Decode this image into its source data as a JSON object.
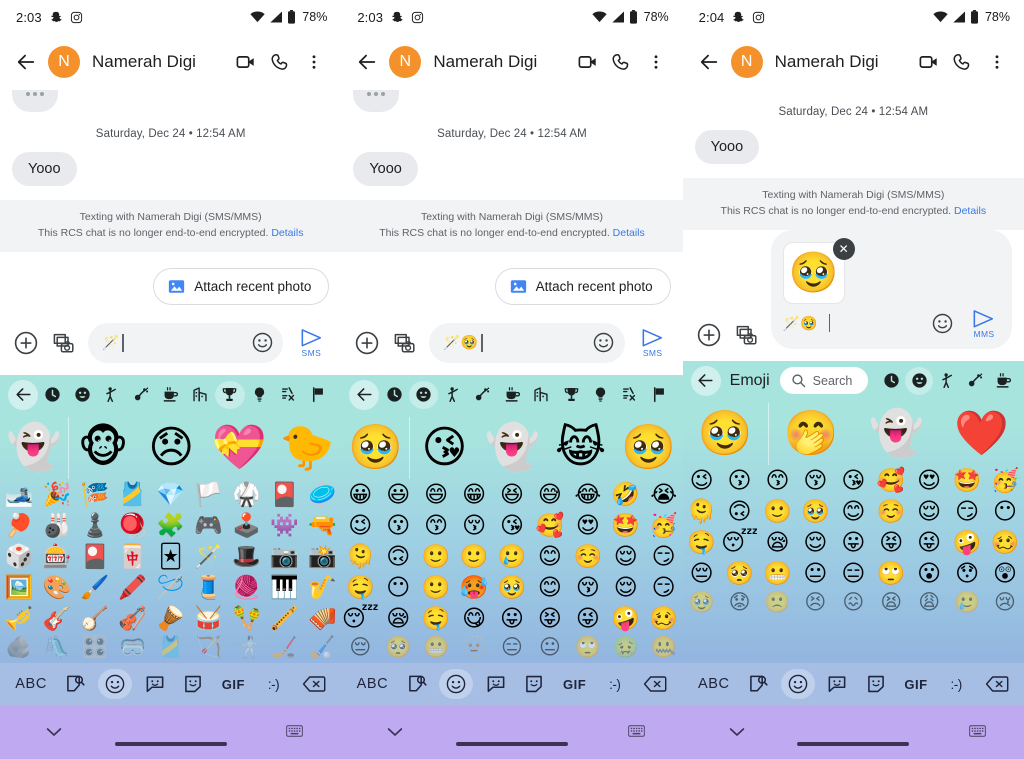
{
  "app": {
    "name": "Google Messages",
    "contact_name": "Namerah Digi",
    "avatar_initial": "N"
  },
  "colors": {
    "accent_blue": "#3b78e7",
    "avatar_orange": "#F5912A",
    "keyboard_top": "#A8E4DE",
    "keyboard_bottom": "#A7BDE4",
    "keyboard_toolbar": "#A6BEE3",
    "navbar_purple": "#BFAAF2",
    "bubble_grey": "#E8EAED",
    "notice_grey": "#F1F3F4"
  },
  "panels": [
    {
      "id": "panel-1",
      "statusbar": {
        "time": "2:03",
        "left_icons": [
          "snapchat-icon",
          "instagram-icon"
        ],
        "right_icons": [
          "wifi-icon",
          "signal-icon",
          "battery-icon"
        ],
        "battery": "78%"
      },
      "appbar": {
        "back": "back-arrow-icon",
        "title": "Namerah Digi",
        "actions": [
          "video-call-icon",
          "phone-call-icon",
          "overflow-menu-icon"
        ]
      },
      "conversation": {
        "typing_indicator": true,
        "datestamp": "Saturday, Dec 24 • 12:54 AM",
        "messages": [
          {
            "from": "them",
            "text": "Yooo"
          }
        ],
        "notice_line1": "Texting with Namerah Digi (SMS/MMS)",
        "notice_line2": "This RCS chat is no longer end-to-end encrypted.",
        "notice_link": "Details"
      },
      "suggestion_chip": {
        "label": "Attach recent photo",
        "icon": "photo-icon"
      },
      "composer": {
        "plus_icon": "plus-circle-icon",
        "gallery_icon": "gallery-camera-icon",
        "text_value": "🪄",
        "placeholder": "Text message",
        "emoji_icon": "smiley-icon",
        "send_icon": "send-icon",
        "send_label": "SMS"
      },
      "keyboard": {
        "show_search": false,
        "back_icon": "back-arrow-icon",
        "label": "",
        "search_placeholder": "",
        "categories": [
          "recent-clock-icon",
          "smileys-icon",
          "people-icon",
          "animals-nature-icon",
          "food-drink-icon",
          "travel-places-icon",
          "activities-icon",
          "objects-icon",
          "symbols-icon",
          "flags-icon"
        ],
        "selected_category": "activities-icon",
        "featured_row": [
          "👻",
          "🐵",
          "😞",
          "💝",
          "🐤"
        ],
        "grid": [
          [
            "🎿",
            "🎉",
            "🎏",
            "🎽",
            "💎",
            "🏳️",
            "🥋",
            "🎴",
            "🥏"
          ],
          [
            "🏓",
            "🎳",
            "♟️",
            "🪀",
            "🧩",
            "🎮",
            "🕹️",
            "👾",
            "🔫"
          ],
          [
            "🎲",
            "🎰",
            "🎴",
            "🀄",
            "🃏",
            "🪄",
            "🎩",
            "📷",
            "📸"
          ],
          [
            "🖼️",
            "🎨",
            "🖌️",
            "🖍️",
            "🪡",
            "🧵",
            "🧶",
            "🎹",
            "🎷"
          ],
          [
            "🎺",
            "🎸",
            "🪕",
            "🎻",
            "🪘",
            "🥁",
            "🪇",
            "🪈",
            "🪗"
          ],
          [
            "🪨",
            "🛝",
            "🎛️",
            "🥽",
            "🎽",
            "🏹",
            "🤺",
            "🏒",
            "🏑"
          ]
        ]
      },
      "kb_toolbar": {
        "items": [
          "ABC",
          "sticker-search-icon",
          "emoji-icon",
          "emoji-kitchen-icon",
          "sticker-icon",
          "GIF",
          ":-)",
          "backspace-icon"
        ],
        "selected": "emoji-icon"
      },
      "navbar": {
        "down_icon": "chevron-down-icon",
        "home_pill": "home-gesture-pill",
        "keyboard_icon": "keyboard-switch-icon"
      }
    },
    {
      "id": "panel-2",
      "statusbar": {
        "time": "2:03",
        "left_icons": [
          "snapchat-icon",
          "instagram-icon"
        ],
        "right_icons": [
          "wifi-icon",
          "signal-icon",
          "battery-icon"
        ],
        "battery": "78%"
      },
      "appbar": {
        "back": "back-arrow-icon",
        "title": "Namerah Digi",
        "actions": [
          "video-call-icon",
          "phone-call-icon",
          "overflow-menu-icon"
        ]
      },
      "conversation": {
        "typing_indicator": true,
        "datestamp": "Saturday, Dec 24 • 12:54 AM",
        "messages": [
          {
            "from": "them",
            "text": "Yooo"
          }
        ],
        "notice_line1": "Texting with Namerah Digi (SMS/MMS)",
        "notice_line2": "This RCS chat is no longer end-to-end encrypted.",
        "notice_link": "Details"
      },
      "suggestion_chip": {
        "label": "Attach recent photo",
        "icon": "photo-icon"
      },
      "composer": {
        "plus_icon": "plus-circle-icon",
        "gallery_icon": "gallery-camera-icon",
        "text_value": "🪄🥹",
        "placeholder": "Text message",
        "emoji_icon": "smiley-icon",
        "send_icon": "send-icon",
        "send_label": "SMS"
      },
      "keyboard": {
        "show_search": false,
        "back_icon": "back-arrow-icon",
        "label": "",
        "search_placeholder": "",
        "categories": [
          "recent-clock-icon",
          "smileys-icon",
          "people-icon",
          "animals-nature-icon",
          "food-drink-icon",
          "travel-places-icon",
          "activities-icon",
          "objects-icon",
          "symbols-icon",
          "flags-icon"
        ],
        "selected_category": "smileys-icon",
        "featured_row": [
          "🥹",
          "😘",
          "👻",
          "😹",
          "🥹"
        ],
        "grid": [
          [
            "😀",
            "😃",
            "😄",
            "😁",
            "😆",
            "😅",
            "😂",
            "🤣",
            "😭"
          ],
          [
            "😉",
            "😗",
            "😙",
            "😚",
            "😘",
            "🥰",
            "😍",
            "🤩",
            "🥳"
          ],
          [
            "🫠",
            "🙃",
            "🙂",
            "🙂",
            "🥲",
            "😊",
            "☺️",
            "😌",
            "😏"
          ],
          [
            "🤤",
            "😶",
            "🙂",
            "🥵",
            "🥹",
            "😊",
            "😚",
            "😌",
            "😏"
          ],
          [
            "😴",
            "😪",
            "🤤",
            "😋",
            "😛",
            "😝",
            "😜",
            "🤪",
            "🥴"
          ],
          [
            "😔",
            "🥺",
            "😬",
            "🫥",
            "😑",
            "😐",
            "🙄",
            "🤢",
            "🤐"
          ]
        ]
      },
      "kb_toolbar": {
        "items": [
          "ABC",
          "sticker-search-icon",
          "emoji-icon",
          "emoji-kitchen-icon",
          "sticker-icon",
          "GIF",
          ":-)",
          "backspace-icon"
        ],
        "selected": "emoji-icon"
      },
      "navbar": {
        "down_icon": "chevron-down-icon",
        "home_pill": "home-gesture-pill",
        "keyboard_icon": "keyboard-switch-icon"
      }
    },
    {
      "id": "panel-3",
      "statusbar": {
        "time": "2:04",
        "left_icons": [
          "snapchat-icon",
          "instagram-icon"
        ],
        "right_icons": [
          "wifi-icon",
          "signal-icon",
          "battery-icon"
        ],
        "battery": "78%"
      },
      "appbar": {
        "back": "back-arrow-icon",
        "title": "Namerah Digi",
        "actions": [
          "video-call-icon",
          "phone-call-icon",
          "overflow-menu-icon"
        ]
      },
      "conversation": {
        "typing_indicator": false,
        "datestamp": "Saturday, Dec 24 • 12:54 AM",
        "messages": [
          {
            "from": "them",
            "text": "Yooo"
          }
        ],
        "notice_line1": "Texting with Namerah Digi (SMS/MMS)",
        "notice_line2": "This RCS chat is no longer end-to-end encrypted.",
        "notice_link": "Details"
      },
      "attachment_draft": {
        "thumbnail_emoji": "🥹",
        "remove_label": "✕",
        "remove_icon": "close-icon"
      },
      "composer": {
        "plus_icon": "plus-circle-icon",
        "gallery_icon": "gallery-camera-icon",
        "text_value": "🪄🥹",
        "placeholder": "Text message",
        "emoji_icon": "smiley-icon",
        "send_icon": "send-icon",
        "send_label": "MMS"
      },
      "keyboard": {
        "show_search": true,
        "back_icon": "back-arrow-icon",
        "label": "Emoji",
        "search_placeholder": "Search",
        "search_icon": "search-icon",
        "categories": [
          "recent-clock-icon",
          "smileys-icon",
          "people-icon",
          "animals-nature-icon",
          "food-drink-icon"
        ],
        "selected_category": "smileys-icon",
        "featured_row": [
          "🥹",
          "🤭",
          "👻",
          "❤️"
        ],
        "grid": [
          [
            "😉",
            "😗",
            "😙",
            "😚",
            "😘",
            "🥰",
            "😍",
            "🤩",
            "🥳"
          ],
          [
            "🫠",
            "🙃",
            "🙂",
            "🥹",
            "😊",
            "☺️",
            "😌",
            "😏",
            "😶"
          ],
          [
            "🤤",
            "😴",
            "😪",
            "😌",
            "😛",
            "😝",
            "😜",
            "🤪",
            "🥴"
          ],
          [
            "😔",
            "🥺",
            "😬",
            "😐",
            "😑",
            "🙄",
            "😮",
            "😯",
            "😲"
          ],
          [
            "🥹",
            "😟",
            "🙁",
            "😣",
            "😖",
            "😫",
            "😩",
            "🥲",
            "😢"
          ]
        ]
      },
      "kb_toolbar": {
        "items": [
          "ABC",
          "sticker-search-icon",
          "emoji-icon",
          "emoji-kitchen-icon",
          "sticker-icon",
          "GIF",
          ":-)",
          "backspace-icon"
        ],
        "selected": "emoji-icon"
      },
      "navbar": {
        "down_icon": "chevron-down-icon",
        "home_pill": "home-gesture-pill",
        "keyboard_icon": "keyboard-switch-icon"
      }
    }
  ]
}
